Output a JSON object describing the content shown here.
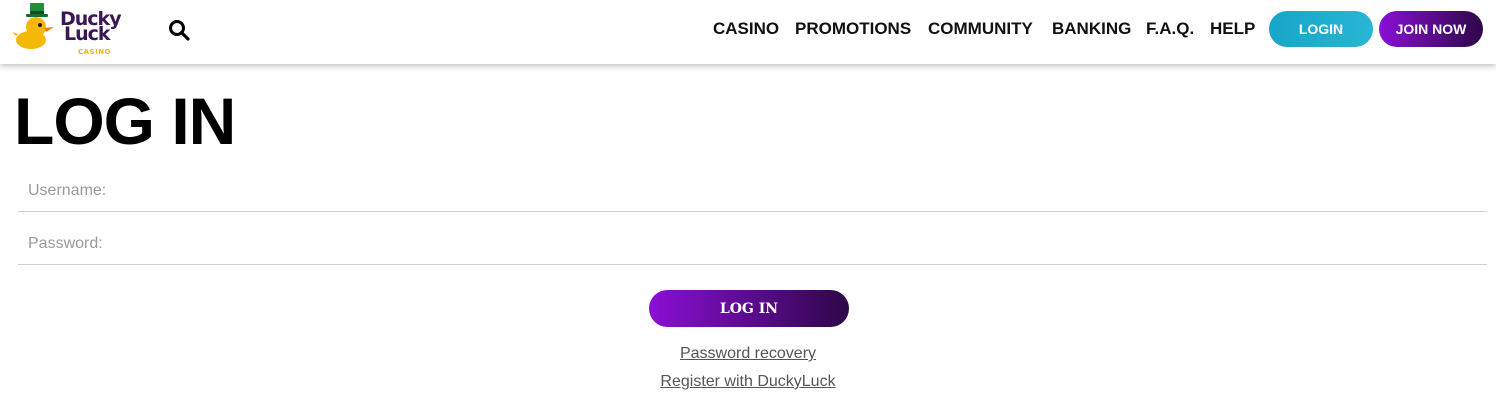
{
  "logo": {
    "wordmark_line1": "Ducky",
    "wordmark_line2": "Luck",
    "sub": "CASINO",
    "colors": {
      "text": "#3b1654",
      "duck": "#f5b800",
      "hat": "#1f8f3a"
    }
  },
  "header": {
    "search_icon": "search-icon",
    "nav": [
      "CASINO",
      "PROMOTIONS",
      "COMMUNITY",
      "BANKING",
      "F.A.Q.",
      "HELP"
    ],
    "login_label": "LOGIN",
    "join_label": "JOIN NOW",
    "colors": {
      "login": "#1fb0cf",
      "join_start": "#8a0fd6",
      "join_end": "#2e0748"
    }
  },
  "main": {
    "title": "LOG IN",
    "username_placeholder": "Username:",
    "password_placeholder": "Password:",
    "submit_label": "LOG IN",
    "recovery_link": "Password recovery",
    "register_link": "Register with DuckyLuck"
  }
}
